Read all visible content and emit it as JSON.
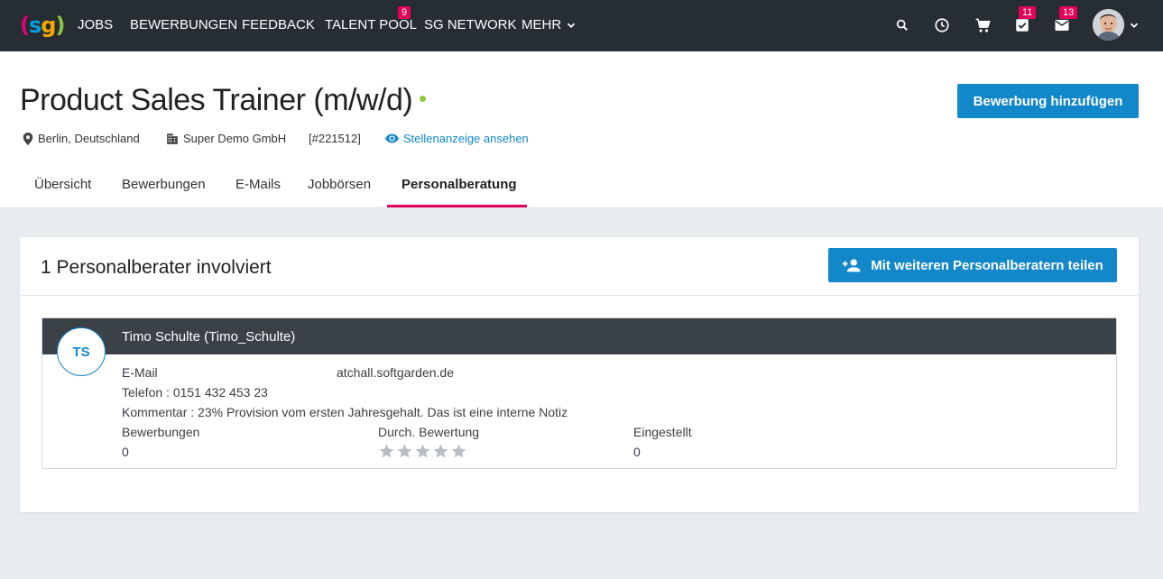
{
  "nav": {
    "logo": {
      "p1": "(",
      "s": "s",
      "g": "g",
      "p2": ")"
    },
    "items": [
      {
        "label": "JOBS"
      },
      {
        "label": "BEWERBUNGEN"
      },
      {
        "label": "FEEDBACK"
      },
      {
        "label": "TALENT POOL",
        "badge": "9"
      },
      {
        "label": "SG NETWORK"
      },
      {
        "label": "MEHR"
      }
    ],
    "icons": {
      "tasks_badge": "11",
      "mail_badge": "13"
    }
  },
  "job": {
    "title": "Product Sales Trainer (m/w/d)",
    "location": "Berlin, Deutschland",
    "company": "Super Demo GmbH",
    "id": "[#221512]",
    "view_ad_link": "Stellenanzeige ansehen",
    "add_application_button": "Bewerbung hinzufügen"
  },
  "tabs": [
    {
      "label": "Übersicht"
    },
    {
      "label": "Bewerbungen"
    },
    {
      "label": "E-Mails"
    },
    {
      "label": "Jobbörsen"
    },
    {
      "label": "Personalberatung",
      "active": true
    }
  ],
  "card": {
    "title": "1 Personalberater involviert",
    "share_button": "Mit weiteren Personalberatern teilen",
    "consultant": {
      "initials": "TS",
      "name": "Timo Schulte (Timo_Schulte)",
      "email_label": "E-Mail",
      "email_value": "atchall.softgarden.de",
      "phone": "Telefon : 0151 432 453 23",
      "comment": "Kommentar : 23% Provision vom ersten Jahresgehalt. Das ist eine interne Notiz",
      "applications_label": "Bewerbungen",
      "applications_value": "0",
      "rating_label": "Durch. Bewertung",
      "rating_stars": 0,
      "rating_max": 5,
      "hired_label": "Eingestellt",
      "hired_value": "0"
    }
  },
  "colors": {
    "nav_bg": "#262d33",
    "primary": "#1287c9",
    "accent": "#e5005a",
    "status_green": "#8dc63f",
    "consultant_bar": "#3a4147"
  }
}
